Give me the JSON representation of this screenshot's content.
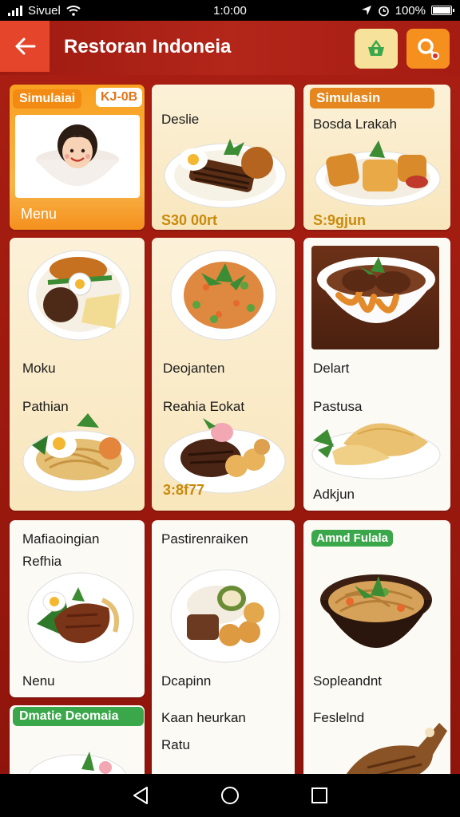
{
  "status_bar": {
    "carrier": "Sivuel",
    "time": "1:0:00",
    "battery": "100%"
  },
  "header": {
    "back_icon": "arrow-left-icon",
    "title": "Restoran Indoneia",
    "cart_icon": "basket-icon",
    "search_icon": "search-icon"
  },
  "cards": {
    "c1": {
      "badge": "Simulaiai",
      "tag": "KJ-0B",
      "label": "Menu"
    },
    "c2": {
      "title": "Deslie",
      "price": "S30 00rt"
    },
    "c3": {
      "badge": "Simulasin",
      "title": "Bosda Lrakah",
      "price": "S:9gjun"
    },
    "c4": {
      "title": "Moku"
    },
    "c5": {
      "title": "Deojanten"
    },
    "c6": {
      "title": "Delart"
    },
    "c7": {
      "title": "Pathian"
    },
    "c8": {
      "title": "Reahia Eokat",
      "price": "3:8f77"
    },
    "c9": {
      "title": "Pastusa",
      "subtitle": "Adkjun"
    },
    "c10": {
      "title": "Mafiaoingian",
      "subtitle": "Refhia",
      "label": "Nenu"
    },
    "c11": {
      "title": "Pastirenraiken",
      "label": "Dcapinn",
      "text1": "Kaan heurkan",
      "text2": "Ratu"
    },
    "c12": {
      "badge": "Amnd Fulala",
      "label": "Sopleandnt",
      "text1": "Feslelnd"
    },
    "c13": {
      "badge": "Dmatie Deomaia"
    }
  },
  "colors": {
    "header_red": "#b3261a",
    "accent_orange": "#f5901e",
    "badge_green": "#3aa84a",
    "price_gold": "#c98a0b"
  },
  "nav": {
    "back": "back-triangle-icon",
    "home": "home-circle-icon",
    "recents": "recents-square-icon"
  }
}
